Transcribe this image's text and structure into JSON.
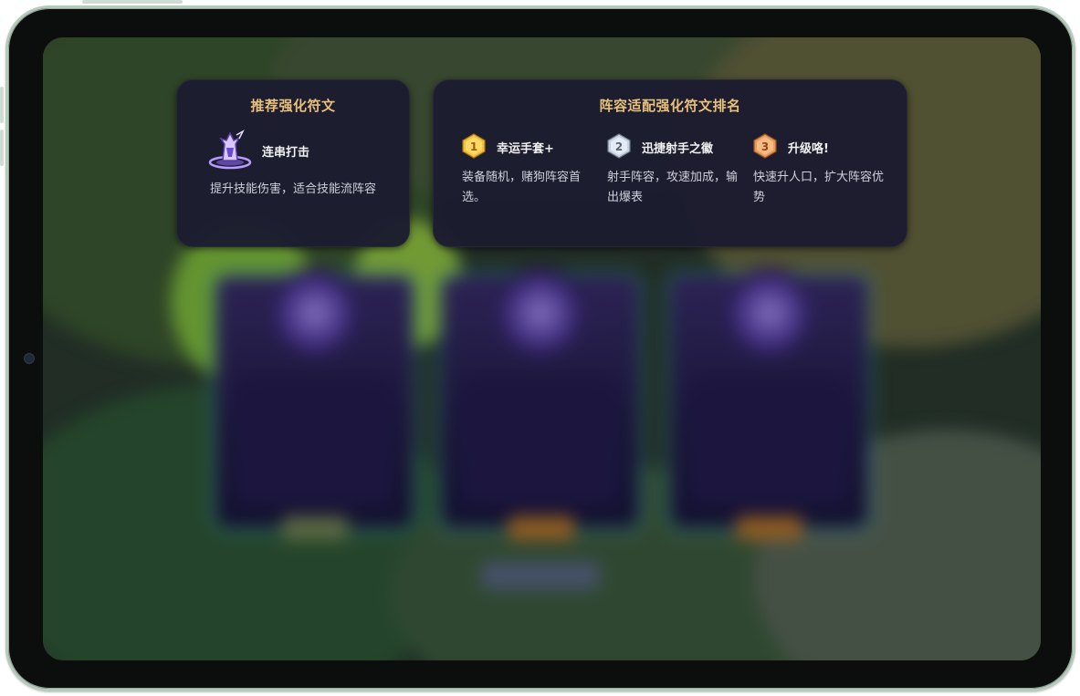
{
  "left_panel": {
    "title": "推荐强化符文",
    "rune": {
      "name": "连串打击",
      "icon": "purple-champion-rune-icon",
      "description": "提升技能伤害，适合技能流阵容"
    }
  },
  "right_panel": {
    "title": "阵容适配强化符文排名",
    "ranks": [
      {
        "rank": "1",
        "badge": "gold-rank-badge",
        "name": "幸运手套+",
        "description": "装备随机，赌狗阵容首选。"
      },
      {
        "rank": "2",
        "badge": "silver-rank-badge",
        "name": "迅捷射手之徽",
        "description": "射手阵容，攻速加成，输出爆表"
      },
      {
        "rank": "3",
        "badge": "bronze-rank-badge",
        "name": "升级咯!",
        "description": "快速升人口，扩大阵容优势"
      }
    ]
  },
  "colors": {
    "panel_bg": "#1c1c30",
    "title_gold": "#e8c07a",
    "gold": "#f2c23a",
    "silver": "#c9d3e0",
    "bronze": "#e89a5a"
  }
}
